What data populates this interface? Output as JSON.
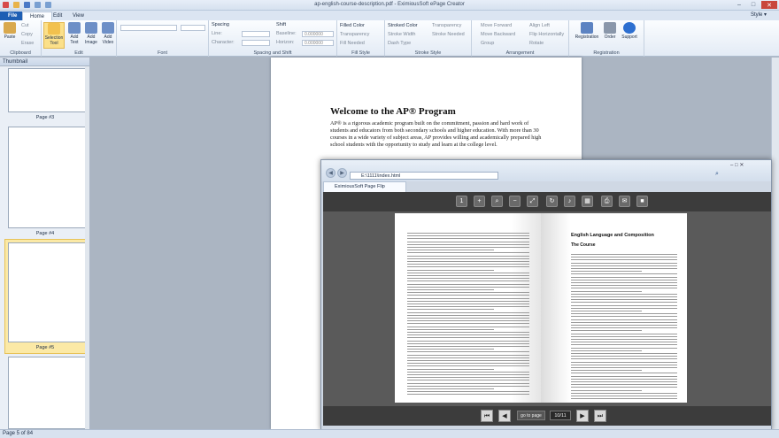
{
  "window": {
    "title": "ap-english-course-description.pdf - EximiousSoft ePage Creator",
    "min": "–",
    "max": "□",
    "close": "✕"
  },
  "tabs": {
    "file": "File",
    "home": "Home",
    "edit": "Edit",
    "view": "View",
    "style": "Style"
  },
  "ribbon": {
    "clipboard": {
      "label": "Clipboard",
      "paste": "Paste",
      "cut": "Cut",
      "copy": "Copy",
      "erase": "Erase"
    },
    "edit": {
      "label": "Edit",
      "selection_tool": "Selection Tool",
      "add_text": "Add Text",
      "add_image": "Add Image",
      "add_video": "Add Video"
    },
    "font": {
      "label": "Font"
    },
    "spacing": {
      "label": "Spacing and Shift",
      "spacing_title": "Spacing",
      "line": "Line:",
      "character": "Character:",
      "shift_title": "Shift",
      "baseline": "Baseline:",
      "horizon": "Horizon:",
      "baseline_val": "0.000000",
      "horizon_val": "0.000000"
    },
    "fill": {
      "label": "Fill Style",
      "filled_color": "Filled Color",
      "transparency": "Transparency",
      "fill_needed": "Fill Needed"
    },
    "stroke": {
      "label": "Stroke Style",
      "stroked_color": "Stroked Color",
      "transparency": "Transparency",
      "stroke_width": "Stroke Width",
      "stroke_needed": "Stroke Needed",
      "dash_type": "Dash Type"
    },
    "arrangement": {
      "label": "Arrangement",
      "move_forward": "Move Forward",
      "move_backward": "Move Backward",
      "group": "Group",
      "align_left": "Align Left",
      "flip_horizontally": "Flip Horizontally",
      "rotate": "Rotate"
    },
    "registration": {
      "label": "Registration",
      "registration": "Registration",
      "order": "Order",
      "support": "Support"
    }
  },
  "thumbnail_panel": {
    "title": "Thumbnail",
    "pages": [
      {
        "label": "Page #3"
      },
      {
        "label": "Page #4"
      },
      {
        "label": "Page #5"
      }
    ]
  },
  "document": {
    "heading": "Welcome to the AP® Program",
    "paragraph": "AP® is a rigorous academic program built on the commitment, passion and hard work of students and educators from both secondary schools and higher education. With more than 30 courses in a wide variety of subject areas, AP provides willing and academically prepared high school students with the opportunity to study and learn at the college level."
  },
  "browser": {
    "address": "E:\\1111\\index.html",
    "search_glyph": "⌕",
    "tab_title": "EximiousSoft Page Flip",
    "book_heading": "English Language and Composition",
    "book_subheading": "The Course",
    "goto_label": "go to page",
    "page_indicator": "10/11",
    "first_btn": "⏮",
    "prev_btn": "◀",
    "next_btn": "▶",
    "last_btn": "⏭"
  },
  "status": {
    "text": "Page 5 of 84"
  }
}
